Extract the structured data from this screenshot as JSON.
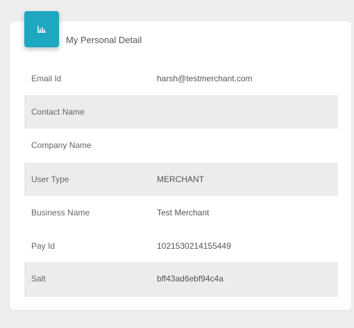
{
  "card": {
    "title": "My Personal Detail",
    "icon": "bar-chart-icon",
    "accent_color": "#1da7c0",
    "rows": [
      {
        "label": "Email Id",
        "value": "harsh@testmerchant.com"
      },
      {
        "label": "Contact Name",
        "value": ""
      },
      {
        "label": "Company Name",
        "value": ""
      },
      {
        "label": "User Type",
        "value": "MERCHANT"
      },
      {
        "label": "Business Name",
        "value": "Test Merchant"
      },
      {
        "label": "Pay Id",
        "value": "1021530214155449"
      },
      {
        "label": "Salt",
        "value": "bff43ad6ebf94c4a"
      }
    ]
  }
}
